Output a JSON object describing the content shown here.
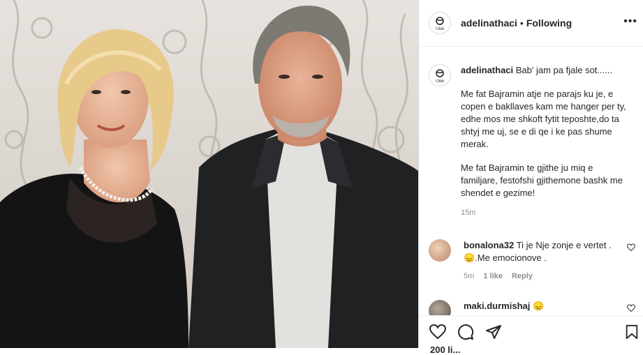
{
  "post": {
    "username": "adelinathaci",
    "separator": "•",
    "follow_status": "Following",
    "more_label": "•••",
    "avatar_text": "CINA"
  },
  "caption": {
    "username": "adelinathaci",
    "title": "Bab' jam pa fjale sot......",
    "paragraph1": "Me fat Bajramin atje ne parajs ku je, e copen e bakllaves kam me hanger per ty, edhe mos me shkoft fytit teposhte,do ta shtyj me uj, se e di qe i ke pas shume merak.",
    "paragraph2": "Me fat Bajramin te gjithe ju miq e familjare, festofshi gjithemone bashk me shendet e gezime!",
    "time": "15m"
  },
  "comments": [
    {
      "username": "bonalona32",
      "text": "Ti je Nje zonje e vertet .😞.Me emocionove .",
      "time": "5m",
      "likes": "1 like",
      "reply": "Reply"
    },
    {
      "username": "maki.durmishaj",
      "text": "😞"
    }
  ],
  "actions": {
    "like_icon": "heart-icon",
    "comment_icon": "comment-icon",
    "share_icon": "share-icon",
    "save_icon": "bookmark-icon",
    "likes_count": "200 li..."
  }
}
